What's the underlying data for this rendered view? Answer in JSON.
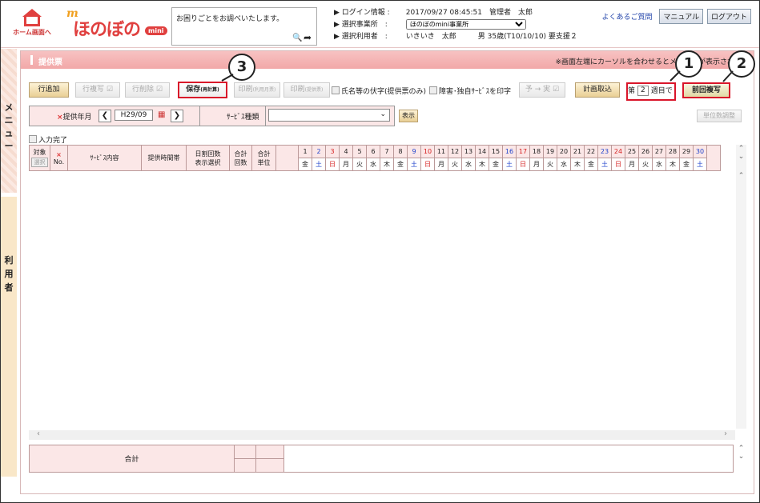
{
  "header": {
    "home_label": "ホーム画面へ",
    "logo_m": "m",
    "logo_text": "ほのぼの",
    "logo_mini": "mini",
    "search_placeholder": "お困りごとをお調べいたします。",
    "login_label": "ログイン情報 :",
    "login_value": "2017/09/27 08:45:51　管理者　太郎",
    "office_label": "選択事業所　:",
    "office_value": "ほのぼのmini事業所",
    "user_label": "選択利用者　:",
    "user_value": "いきいき　太郎　　　男 35歳(T10/10/10) 要支援２",
    "faq": "よくあるご質問",
    "manual": "マニュアル",
    "logout": "ログアウト"
  },
  "side": {
    "menu": [
      "メ",
      "ニ",
      "ュ",
      "ー"
    ],
    "user": [
      "利",
      "用",
      "者"
    ]
  },
  "main": {
    "title": "提供票",
    "note": "※画面左端にカーソルを合わせるとメニューが表示されます",
    "buttons": {
      "add_row": "行追加",
      "copy_row": "行複写 ☑",
      "delete_row": "行削除 ☑",
      "save": "保存",
      "save_sub": "(再計算)",
      "print1": "印刷",
      "print1_sub": "(利用月票)",
      "print2": "印刷",
      "print2_sub": "(提供票)",
      "plan_actual": "予 → 実 ☑",
      "plan_import": "計画取込",
      "prev_copy": "前回複写",
      "unit_adjust": "単位数調整",
      "display": "表示"
    },
    "checks": {
      "name_hide": "氏名等の伏字(提供票のみ)",
      "disability": "障害･独自ｻｰﾋﾞｽを印字"
    },
    "week": {
      "prefix": "第",
      "value": "2",
      "suffix": "週目で"
    },
    "filter": {
      "req_mark": "×",
      "month_label": "提供年月",
      "month_value": "H29/09",
      "service_label": "ｻｰﾋﾞｽ種類",
      "service_value": ""
    },
    "input_done": "入力完了"
  },
  "grid": {
    "target": "対象",
    "select": "選択",
    "no_mark": "×",
    "no": "No.",
    "service": "ｻｰﾋﾞｽ内容",
    "time": "提供時間帯",
    "split": [
      "日割回数",
      "表示選択"
    ],
    "total_count": [
      "合計",
      "回数"
    ],
    "total_unit": [
      "合計",
      "単位"
    ],
    "days": [
      "1",
      "2",
      "3",
      "4",
      "5",
      "6",
      "7",
      "8",
      "9",
      "10",
      "11",
      "12",
      "13",
      "14",
      "15",
      "16",
      "17",
      "18",
      "19",
      "20",
      "21",
      "22",
      "23",
      "24",
      "25",
      "26",
      "27",
      "28",
      "29",
      "30"
    ],
    "weekdays": [
      "金",
      "土",
      "日",
      "月",
      "火",
      "水",
      "木",
      "金",
      "土",
      "日",
      "月",
      "火",
      "水",
      "木",
      "金",
      "土",
      "日",
      "月",
      "火",
      "水",
      "木",
      "金",
      "土",
      "日",
      "月",
      "火",
      "水",
      "木",
      "金",
      "土"
    ]
  },
  "total": {
    "label": "合計"
  },
  "badges": [
    "1",
    "2",
    "3"
  ]
}
